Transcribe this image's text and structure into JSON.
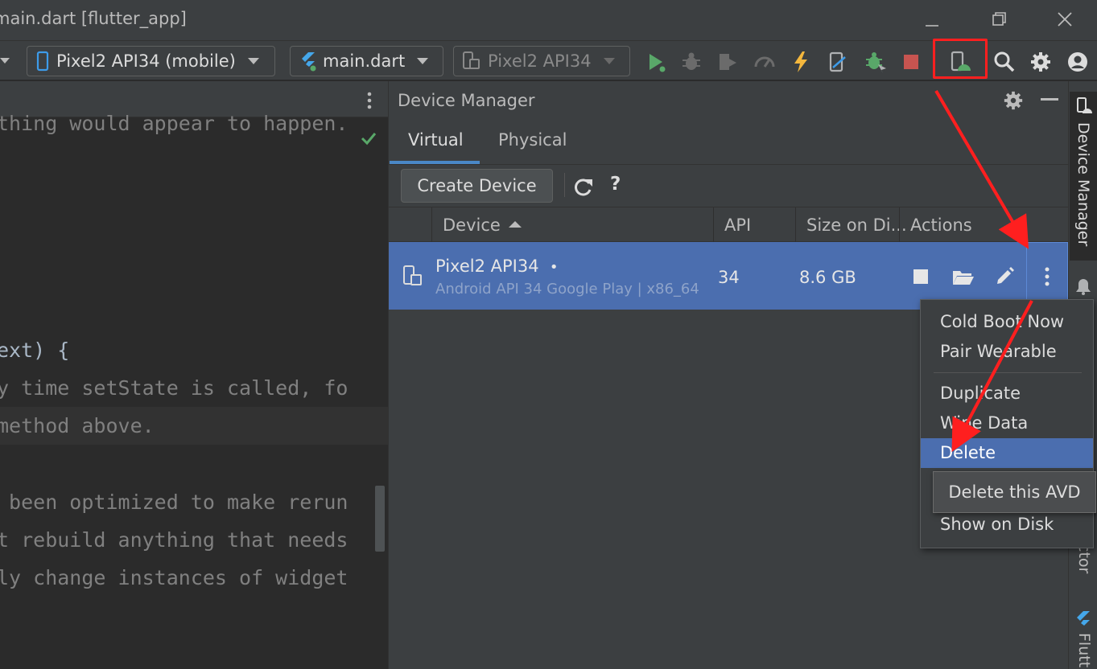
{
  "window": {
    "title": "main.dart [flutter_app]",
    "minimize_glyph": "—",
    "restore_glyph": "❐",
    "close_glyph": "✕"
  },
  "toolbar": {
    "device_combo": "Pixel2 API34 (mobile)",
    "config_combo": "main.dart",
    "run_target_combo": "Pixel2 API34",
    "icons": [
      "run-icon",
      "debug-icon",
      "profile-icon",
      "attach-icon",
      "hot-reload-icon",
      "device-sync-icon",
      "debug-attach-icon",
      "stop-icon",
      "device-manager-icon",
      "search-icon",
      "settings-icon",
      "account-icon"
    ],
    "accent_run": "#59a869",
    "accent_stop": "#c75450",
    "accent_hot_reload": "#f4b73d"
  },
  "editor": {
    "lines": [
      {
        "text": "thing would appear to happen.",
        "comment": true
      },
      {
        "text": "ext) {",
        "comment": false
      },
      {
        "text": "y time setState is called, fo",
        "comment": true
      },
      {
        "text": "method above.",
        "comment": true
      },
      {
        "text": " been optimized to make rerun",
        "comment": true
      },
      {
        "text": "t rebuild anything that needs",
        "comment": true
      },
      {
        "text": "ly change instances of widget",
        "comment": true
      }
    ]
  },
  "device_manager": {
    "title": "Device Manager",
    "tabs": [
      {
        "label": "Virtual",
        "active": true
      },
      {
        "label": "Physical",
        "active": false
      }
    ],
    "create_button": "Create Device",
    "help_glyph": "?",
    "columns": {
      "device": "Device",
      "api": "API",
      "size": "Size on Di...",
      "actions": "Actions"
    },
    "devices": [
      {
        "name": "Pixel2 API34",
        "status_dot": "•",
        "subtitle": "Android API 34 Google Play | x86_64",
        "api": "34",
        "size": "8.6 GB"
      }
    ]
  },
  "context_menu": {
    "items": [
      {
        "label": "Cold Boot Now"
      },
      {
        "label": "Pair Wearable"
      },
      {
        "label": "Duplicate"
      },
      {
        "label": "Wipe Data"
      },
      {
        "label": "Delete",
        "selected": true
      },
      {
        "label": "Show on Disk"
      }
    ],
    "tooltip": "Delete this AVD"
  },
  "right_stripe": {
    "device_manager_label": "Device Manager",
    "inspector_label_fragment": "ctor",
    "flutter_label_fragment": "Flutt"
  },
  "colors": {
    "selection": "#4b6eaf",
    "annotation_red": "#ff1f1f",
    "tab_accent": "#4a88c7"
  }
}
